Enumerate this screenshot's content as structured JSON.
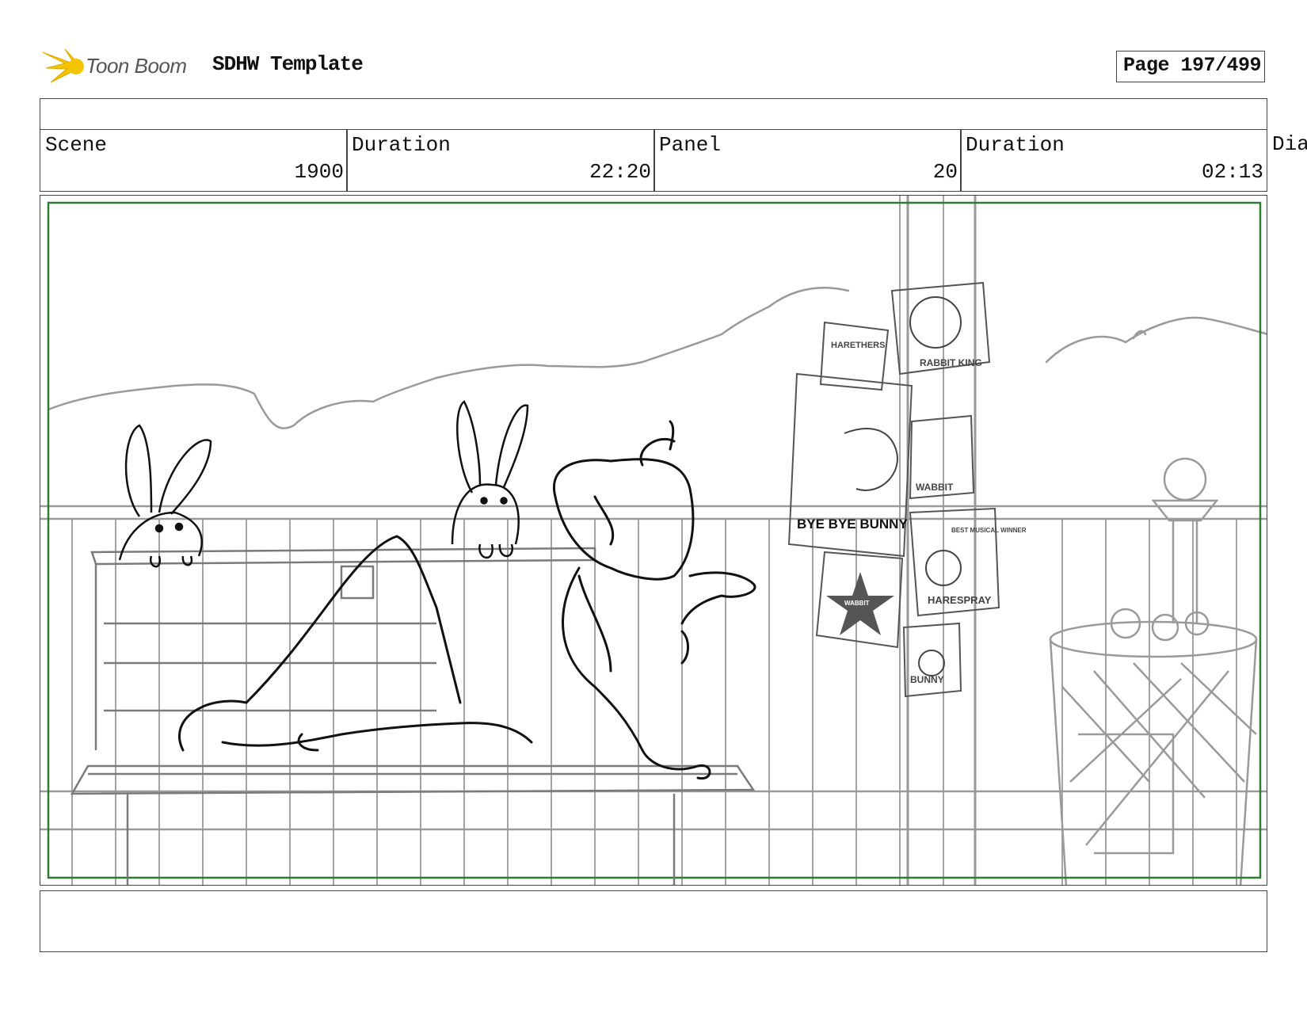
{
  "header": {
    "logo_text": "Toon Boom",
    "template_title": "SDHW Template",
    "page_label": "Page 197/499"
  },
  "info": {
    "scene_label": "Scene",
    "scene_value": "1900",
    "scene_duration_label": "Duration",
    "scene_duration_value": "22:20",
    "panel_label": "Panel",
    "panel_value": "20",
    "panel_duration_label": "Duration",
    "panel_duration_value": "02:13",
    "dialogue_label": "Dia"
  },
  "sketch": {
    "posters": {
      "p1": "HARETHERS",
      "p2": "RABBIT KING",
      "p3": "BYE BYE BUNNY",
      "p4": "WABBIT",
      "p5": "BEST MUSICAL WINNER",
      "p6": "HARESPRAY",
      "p7": "WABBIT",
      "p8": "BUNNY"
    }
  },
  "colors": {
    "safe_frame": "#2e7d32",
    "background_lines": "#9a9a9a",
    "ink": "#111111",
    "logo_yellow": "#f5c400"
  }
}
